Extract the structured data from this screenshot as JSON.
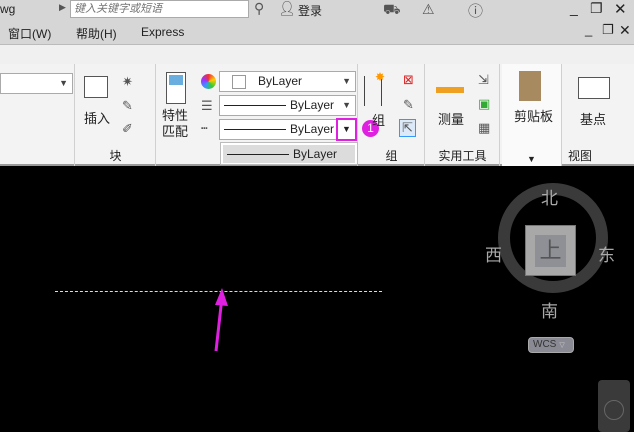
{
  "titlebar": {
    "filename_fragment": "wg",
    "search_placeholder": "键入关键字或短语",
    "login": "登录"
  },
  "menu": [
    "窗口(W)",
    "帮助(H)",
    "Express"
  ],
  "ribbon": {
    "block_panel": {
      "insert": "插入",
      "label": "块"
    },
    "properties_panel": {
      "match": "特性\n匹配",
      "match_line1": "特性",
      "match_line2": "匹配",
      "color": "ByLayer",
      "linetype": "ByLayer",
      "lineweight": "ByLayer",
      "open_option": "ByLayer"
    },
    "group_panel": {
      "group": "组",
      "label": "组"
    },
    "utilities_panel": {
      "measure": "测量",
      "label": "实用工具"
    },
    "clipboard_panel": {
      "label": "剪贴板"
    },
    "view_panel": {
      "basepoint": "基点",
      "label": "视图"
    },
    "step_badge": "1"
  },
  "viewcube": {
    "north": "北",
    "south": "南",
    "west": "西",
    "east": "东",
    "face": "上",
    "wcs": "WCS"
  },
  "colors": {
    "accent": "#e020e0",
    "canvas": "#000000"
  }
}
